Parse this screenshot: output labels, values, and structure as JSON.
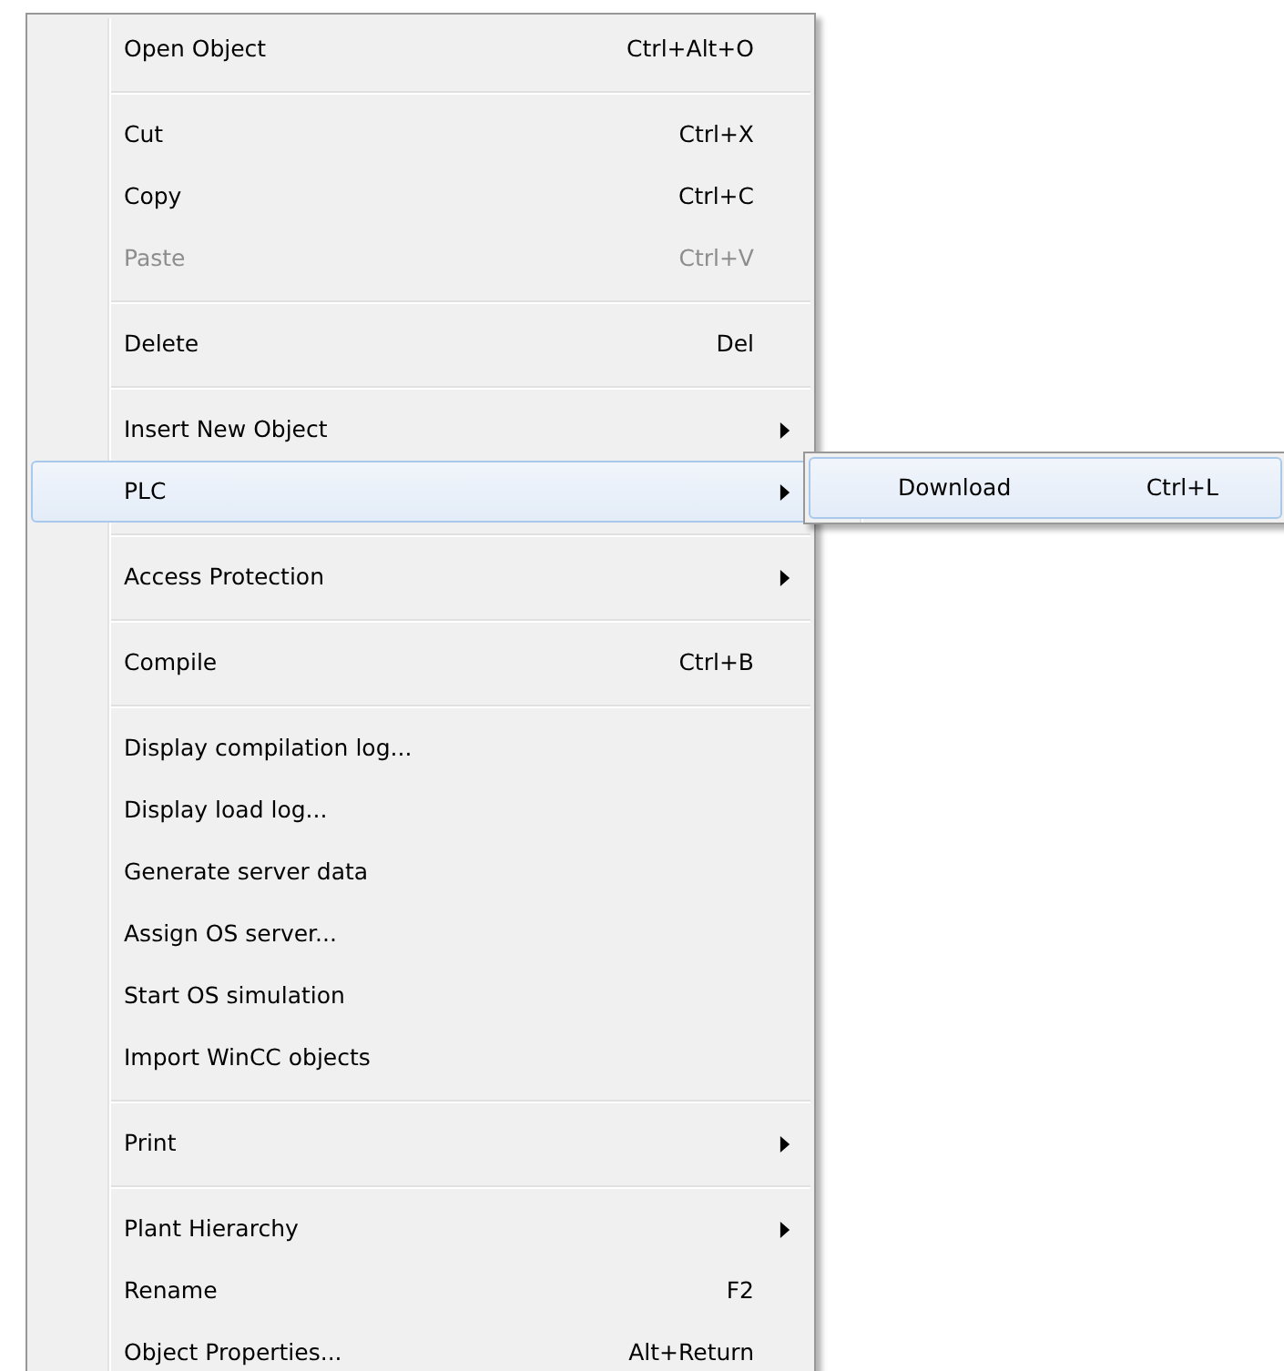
{
  "context_menu": {
    "groups": [
      {
        "items": [
          {
            "label": "Open Object",
            "shortcut": "Ctrl+Alt+O",
            "submenu": false,
            "disabled": false,
            "selected": false
          }
        ]
      },
      {
        "items": [
          {
            "label": "Cut",
            "shortcut": "Ctrl+X",
            "submenu": false,
            "disabled": false,
            "selected": false
          },
          {
            "label": "Copy",
            "shortcut": "Ctrl+C",
            "submenu": false,
            "disabled": false,
            "selected": false
          },
          {
            "label": "Paste",
            "shortcut": "Ctrl+V",
            "submenu": false,
            "disabled": true,
            "selected": false
          }
        ]
      },
      {
        "items": [
          {
            "label": "Delete",
            "shortcut": "Del",
            "submenu": false,
            "disabled": false,
            "selected": false
          }
        ]
      },
      {
        "items": [
          {
            "label": "Insert New Object",
            "submenu": true,
            "disabled": false,
            "selected": false
          },
          {
            "label": "PLC",
            "submenu": true,
            "disabled": false,
            "selected": true
          }
        ]
      },
      {
        "items": [
          {
            "label": "Access Protection",
            "submenu": true,
            "disabled": false,
            "selected": false
          }
        ]
      },
      {
        "items": [
          {
            "label": "Compile",
            "shortcut": "Ctrl+B",
            "submenu": false,
            "disabled": false,
            "selected": false
          }
        ]
      },
      {
        "items": [
          {
            "label": "Display compilation log...",
            "submenu": false,
            "disabled": false,
            "selected": false
          },
          {
            "label": "Display load log...",
            "submenu": false,
            "disabled": false,
            "selected": false
          },
          {
            "label": "Generate server data",
            "submenu": false,
            "disabled": false,
            "selected": false
          },
          {
            "label": "Assign OS server...",
            "submenu": false,
            "disabled": false,
            "selected": false
          },
          {
            "label": "Start OS simulation",
            "submenu": false,
            "disabled": false,
            "selected": false
          },
          {
            "label": "Import WinCC objects",
            "submenu": false,
            "disabled": false,
            "selected": false
          }
        ]
      },
      {
        "items": [
          {
            "label": "Print",
            "submenu": true,
            "disabled": false,
            "selected": false
          }
        ]
      },
      {
        "items": [
          {
            "label": "Plant Hierarchy",
            "submenu": true,
            "disabled": false,
            "selected": false
          },
          {
            "label": "Rename",
            "shortcut": "F2",
            "submenu": false,
            "disabled": false,
            "selected": false
          },
          {
            "label": "Object Properties...",
            "shortcut": "Alt+Return",
            "submenu": false,
            "disabled": false,
            "selected": false
          }
        ]
      }
    ]
  },
  "submenu": {
    "items": [
      {
        "label": "Download",
        "shortcut": "Ctrl+L",
        "selected": true
      }
    ]
  }
}
